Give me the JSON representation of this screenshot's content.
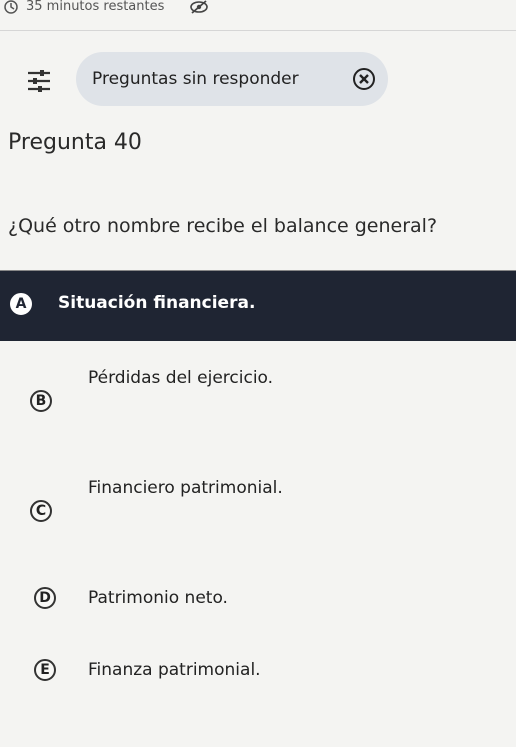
{
  "header": {
    "timer_text": "35 minutos restantes"
  },
  "filter": {
    "label": "Preguntas sin responder"
  },
  "question": {
    "number_label": "Pregunta 40",
    "text": "¿Qué otro nombre recibe el balance general?"
  },
  "options": [
    {
      "letter": "A",
      "text": "Situación financiera.",
      "selected": true
    },
    {
      "letter": "B",
      "text": "Pérdidas del ejercicio.",
      "selected": false
    },
    {
      "letter": "C",
      "text": "Financiero patrimonial.",
      "selected": false
    },
    {
      "letter": "D",
      "text": "Patrimonio neto.",
      "selected": false
    },
    {
      "letter": "E",
      "text": "Finanza patrimonial.",
      "selected": false
    }
  ],
  "colors": {
    "selected_bg": "#1f2533",
    "pill_bg": "#dfe3e8",
    "page_bg": "#f4f4f2"
  }
}
